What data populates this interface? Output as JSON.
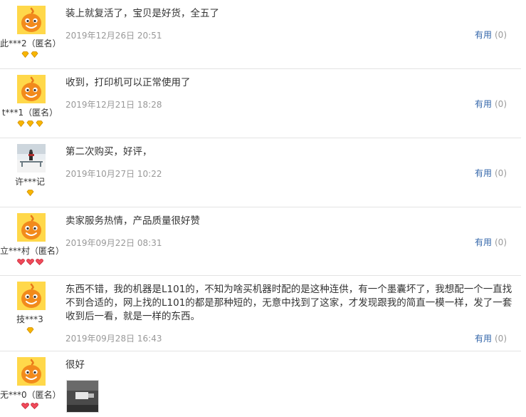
{
  "reviews": [
    {
      "nick": "此***2（匿名）",
      "avatar": "mascot",
      "level_icon": "gold-diamond-icon",
      "level_count": 2,
      "content": "装上就复活了，宝贝是好货，全五了",
      "date": "2019年12月26日 20:51",
      "useful_label": "有用",
      "useful_count": "(0)"
    },
    {
      "nick": "t***1（匿名）",
      "avatar": "mascot",
      "level_icon": "gold-diamond-icon",
      "level_count": 3,
      "content": "收到，打印机可以正常使用了",
      "date": "2019年12月21日 18:28",
      "useful_label": "有用",
      "useful_count": "(0)"
    },
    {
      "nick": "许***记",
      "avatar": "photo",
      "level_icon": "gold-diamond-icon",
      "level_count": 1,
      "content": "第二次购买，好评，",
      "date": "2019年10月27日 10:22",
      "useful_label": "有用",
      "useful_count": "(0)"
    },
    {
      "nick": "立***村（匿名）",
      "avatar": "mascot",
      "level_icon": "red-heart-icon",
      "level_count": 3,
      "content": "卖家服务热情，产品质量很好赞",
      "date": "2019年09月22日 08:31",
      "useful_label": "有用",
      "useful_count": "(0)"
    },
    {
      "nick": "技***3",
      "avatar": "mascot",
      "level_icon": "gold-diamond-icon",
      "level_count": 1,
      "content": "东西不错，我的机器是L101的，不知为啥买机器时配的是这种连供，有一个墨囊坏了，我想配一个一直找不到合适的，网上找的L101的都是那种短的，无意中找到了这家，才发现跟我的简直一模一样，发了一套收到后一看，就是一样的东西。",
      "date": "2019年09月28日 16:43",
      "useful_label": "有用",
      "useful_count": "(0)"
    },
    {
      "nick": "无***0（匿名）",
      "avatar": "mascot",
      "level_icon": "red-heart-icon",
      "level_count": 2,
      "content": "很好",
      "has_photo": true
    }
  ]
}
